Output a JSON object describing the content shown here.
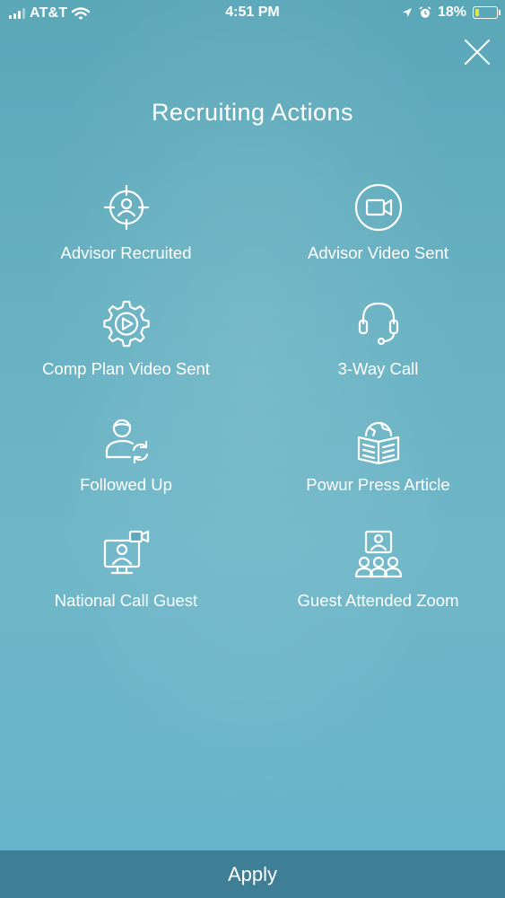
{
  "status_bar": {
    "carrier": "AT&T",
    "time": "4:51 PM",
    "battery_percent": "18%",
    "battery_level": 0.18
  },
  "header": {
    "title": "Recruiting Actions",
    "close_icon": "close-icon"
  },
  "actions": [
    {
      "label": "Advisor Recruited",
      "icon": "target-person-icon"
    },
    {
      "label": "Advisor Video Sent",
      "icon": "video-camera-icon"
    },
    {
      "label": "Comp Plan Video Sent",
      "icon": "gear-play-icon"
    },
    {
      "label": "3-Way Call",
      "icon": "headset-icon"
    },
    {
      "label": "Followed Up",
      "icon": "person-refresh-icon"
    },
    {
      "label": "Powur Press Article",
      "icon": "globe-book-icon"
    },
    {
      "label": "National Call Guest",
      "icon": "monitor-video-icon"
    },
    {
      "label": "Guest Attended Zoom",
      "icon": "group-video-icon"
    }
  ],
  "footer": {
    "apply_label": "Apply"
  },
  "colors": {
    "background": "#67b1c2",
    "apply_bar": "#3f7f96",
    "text": "#ffffff",
    "battery_fill": "#e8e04a"
  }
}
